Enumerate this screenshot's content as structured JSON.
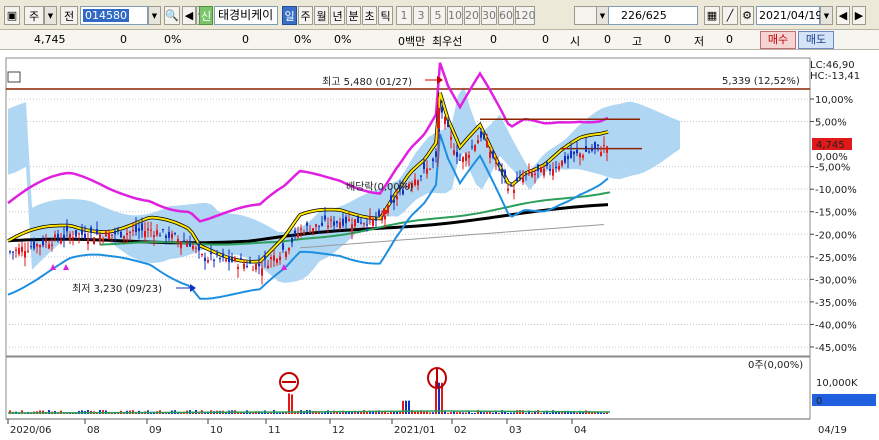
{
  "toolbar": {
    "period_label": "주",
    "prev_label": "전",
    "code": "014580",
    "credit_label": "신",
    "stock_name": "태경비케이",
    "interval_tabs": [
      {
        "label": "일",
        "selected": true
      },
      {
        "label": "주",
        "selected": false
      },
      {
        "label": "월",
        "selected": false
      },
      {
        "label": "년",
        "selected": false
      },
      {
        "label": "분",
        "selected": false
      },
      {
        "label": "초",
        "selected": false
      },
      {
        "label": "틱",
        "selected": false
      }
    ],
    "minute_buttons": [
      "1",
      "3",
      "5",
      "10",
      "20",
      "30",
      "60",
      "120"
    ],
    "count": "226",
    "total": "/625",
    "date": "2021/04/19"
  },
  "quote": {
    "price": "4,745",
    "v1": "0",
    "p1": "0%",
    "v2": "0",
    "p2": "0%",
    "p3": "0%",
    "vol_unit": "0백만",
    "order_label": "최우선",
    "b1": "0",
    "b2": "0",
    "open_label": "시",
    "open": "0",
    "high_label": "고",
    "high": "0",
    "low_label": "저",
    "low": "0",
    "buy_label": "매수",
    "sell_label": "매도"
  },
  "chart": {
    "lc_label": "LC:46,90",
    "hc_label": "HC:-13,41",
    "max_label": "최고 5,480 (01/27)",
    "min_label": "최저 3,230 (09/23)",
    "ref_label": "5,339 (12,52%)",
    "dividend_label": "배당락(0,00%)",
    "current_price": "4,745",
    "current_pct": "0,00%",
    "y_ticks": [
      "10,00%",
      "5,00%",
      "-5,00%",
      "-10,00%",
      "-15,00%",
      "-20,00%",
      "-25,00%",
      "-30,00%",
      "-35,00%",
      "-40,00%",
      "-45,00%"
    ],
    "volume_label": "0주(0,00%)",
    "volume_ticks": [
      "10,000K",
      "0"
    ],
    "x_labels": [
      "2020/06",
      "08",
      "09",
      "10",
      "11",
      "12",
      "2021/01",
      "02",
      "03",
      "04"
    ],
    "end_date": "04/19",
    "colors": {
      "up": "#e01818",
      "down": "#1030c0",
      "envelope": "#e020e0",
      "band": "#ffe600",
      "bollinger": "#1e8fe0",
      "ma_long": "#000000",
      "ma_mid": "#2ca05a",
      "cloud": "#a6d2f2",
      "highlight": "#ffc48a",
      "ref_line": "#8b2500"
    }
  }
}
